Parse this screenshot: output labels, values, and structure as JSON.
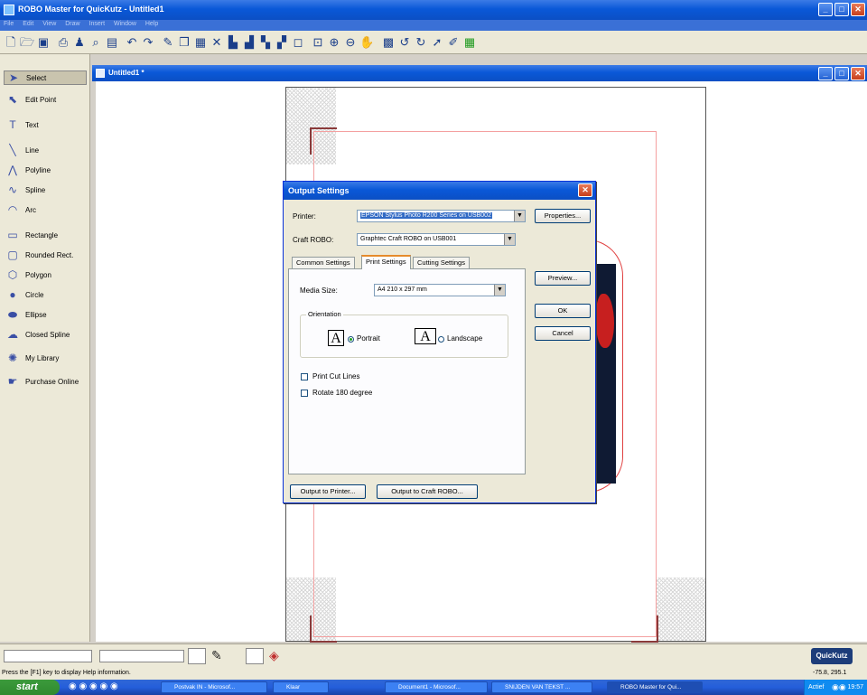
{
  "app": {
    "title": "ROBO Master for QuicKutz - Untitled1"
  },
  "menu": [
    "File",
    "Edit",
    "View",
    "Draw",
    "Insert",
    "Window",
    "Help"
  ],
  "toolbar_icons": [
    "new-file-icon",
    "open-file-icon",
    "save-icon",
    "print-icon",
    "people-icon",
    "print-preview-icon",
    "zoom-doc-icon",
    "undo-icon",
    "redo-icon",
    "edit-icon",
    "copy-icon",
    "paste-icon",
    "delete-icon",
    "align-icon",
    "align2-icon",
    "align3-icon",
    "align4-icon",
    "group-icon",
    "zoom-fit-icon",
    "zoom-in-icon",
    "zoom-out-icon",
    "pan-icon",
    "library-icon",
    "rotate-icon",
    "rotate2-icon",
    "arrow-icon",
    "pencil-icon",
    "grid-icon"
  ],
  "tools": [
    {
      "label": "Select",
      "icon": "pointer-icon"
    },
    {
      "label": "Edit Point",
      "icon": "edit-point-icon"
    },
    {
      "label": "Text",
      "icon": "text-icon"
    },
    {
      "label": "Line",
      "icon": "line-icon"
    },
    {
      "label": "Polyline",
      "icon": "polyline-icon"
    },
    {
      "label": "Spline",
      "icon": "spline-icon"
    },
    {
      "label": "Arc",
      "icon": "arc-icon"
    },
    {
      "label": "Rectangle",
      "icon": "rectangle-icon"
    },
    {
      "label": "Rounded Rect.",
      "icon": "rounded-rect-icon"
    },
    {
      "label": "Polygon",
      "icon": "polygon-icon"
    },
    {
      "label": "Circle",
      "icon": "circle-icon"
    },
    {
      "label": "Ellipse",
      "icon": "ellipse-icon"
    },
    {
      "label": "Closed Spline",
      "icon": "closed-spline-icon"
    },
    {
      "label": "My Library",
      "icon": "library-icon"
    },
    {
      "label": "Purchase Online",
      "icon": "purchase-icon"
    }
  ],
  "document": {
    "title": "Untitled1 *"
  },
  "dialog": {
    "title": "Output Settings",
    "printer_label": "Printer:",
    "printer_value": "EPSON Stylus Photo R200 Series on USB002",
    "craft_label": "Craft ROBO:",
    "craft_value": "Graphtec Craft ROBO on USB001",
    "properties_label": "Properties...",
    "tabs": [
      "Common Settings",
      "Print Settings",
      "Cutting Settings"
    ],
    "active_tab": "Print Settings",
    "media_label": "Media Size:",
    "media_value": "A4 210 x 297 mm",
    "orientation_label": "Orientation",
    "portrait_label": "Portrait",
    "landscape_label": "Landscape",
    "orientation_value": "Portrait",
    "print_cut_label": "Print Cut Lines",
    "rotate_label": "Rotate 180 degree",
    "preview_label": "Preview...",
    "ok_label": "OK",
    "cancel_label": "Cancel",
    "output_printer_label": "Output to Printer...",
    "output_craft_label": "Output to Craft ROBO..."
  },
  "status": {
    "help_text": "Press the [F1] key to display Help information.",
    "coords": "-75.8, 295.1",
    "logo": "QuicKutz"
  },
  "taskbar": {
    "start_label": "start",
    "tasks": [
      "Postvak IN - Microsof...",
      "Klaar",
      "Document1 - Microsof...",
      "SNIJDEN VAN TEKST ...",
      "ROBO Master for Qui..."
    ],
    "tray_text": "Actief",
    "clock": "19:57"
  },
  "colors": {
    "titlebar": "#0a58d8",
    "chrome": "#ece9d8",
    "selection": "#316ac5",
    "cut_line": "#e04040"
  }
}
